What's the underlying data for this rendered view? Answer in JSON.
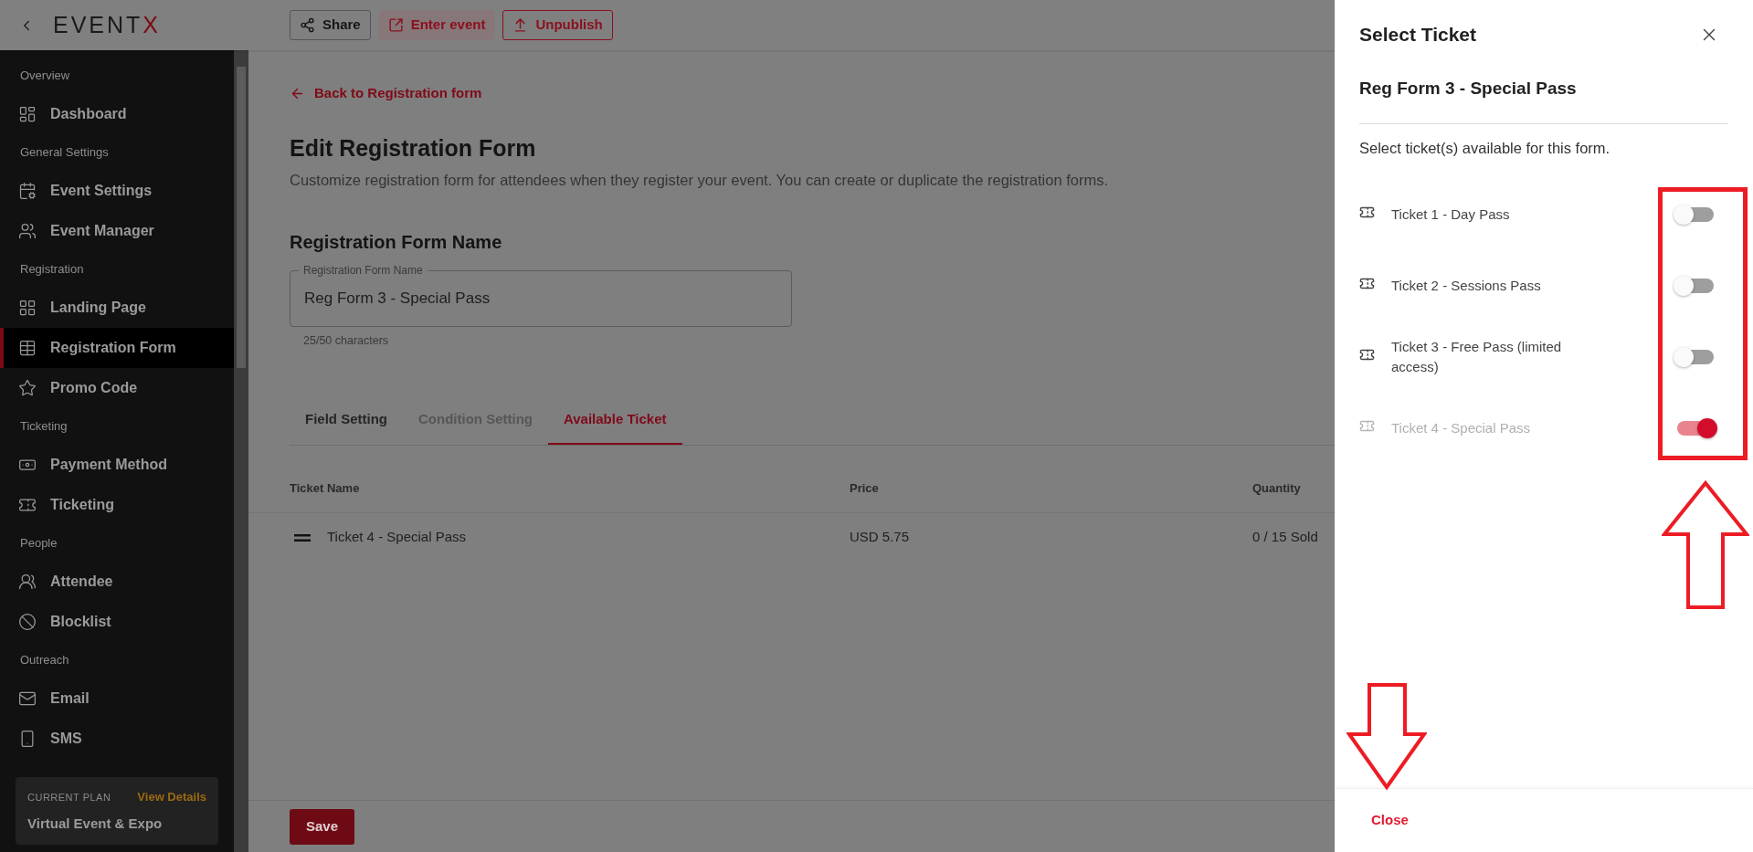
{
  "header": {
    "logo_main": "EVENT",
    "logo_accent": "X",
    "toolbar": [
      {
        "label": "Share",
        "kind": "outline"
      },
      {
        "label": "Enter event",
        "kind": "tinted"
      },
      {
        "label": "Unpublish",
        "kind": "danger"
      }
    ]
  },
  "sidebar": {
    "sections": [
      {
        "title": "Overview",
        "items": [
          {
            "label": "Dashboard",
            "selected": false
          }
        ]
      },
      {
        "title": "General Settings",
        "items": [
          {
            "label": "Event Settings",
            "selected": false
          },
          {
            "label": "Event Manager",
            "selected": false
          }
        ]
      },
      {
        "title": "Registration",
        "items": [
          {
            "label": "Landing Page",
            "selected": false
          },
          {
            "label": "Registration Form",
            "selected": true
          },
          {
            "label": "Promo Code",
            "selected": false
          }
        ]
      },
      {
        "title": "Ticketing",
        "items": [
          {
            "label": "Payment Method",
            "selected": false
          },
          {
            "label": "Ticketing",
            "selected": false
          }
        ]
      },
      {
        "title": "People",
        "items": [
          {
            "label": "Attendee",
            "selected": false
          },
          {
            "label": "Blocklist",
            "selected": false
          }
        ]
      },
      {
        "title": "Outreach",
        "items": [
          {
            "label": "Email",
            "selected": false
          },
          {
            "label": "SMS",
            "selected": false
          }
        ]
      }
    ],
    "plan": {
      "caption": "CURRENT PLAN",
      "link": "View Details",
      "name": "Virtual Event & Expo"
    }
  },
  "page": {
    "back_link": "Back to Registration form",
    "title": "Edit Registration Form",
    "description": "Customize registration form for attendees when they register your event. You can create or duplicate the registration forms.",
    "section_title": "Registration Form Name",
    "name_field": {
      "label": "Registration Form Name",
      "value": "Reg Form 3 - Special Pass",
      "counter": "25/50 characters"
    },
    "tabs": [
      {
        "label": "Field Setting",
        "selected": false,
        "disabled": false
      },
      {
        "label": "Condition Setting",
        "selected": false,
        "disabled": true
      },
      {
        "label": "Available Ticket",
        "selected": true,
        "disabled": false
      }
    ],
    "table": {
      "columns": [
        "Ticket Name",
        "Price",
        "Quantity"
      ],
      "rows": [
        {
          "cells": [
            "Ticket 4 - Special Pass",
            "USD 5.75",
            "0 / 15 Sold"
          ]
        }
      ]
    },
    "save": "Save"
  },
  "drawer": {
    "title": "Select Ticket",
    "form_name": "Reg Form 3 - Special Pass",
    "instruction": "Select ticket(s) available for this form.",
    "tickets": [
      {
        "name": "Ticket 1 - Day Pass",
        "on": false,
        "disabled": false
      },
      {
        "name": "Ticket 2 - Sessions Pass",
        "on": false,
        "disabled": false
      },
      {
        "name": "Ticket 3 - Free Pass (limited access)",
        "on": false,
        "disabled": false
      },
      {
        "name": "Ticket 4 - Special Pass",
        "on": true,
        "disabled": true
      }
    ],
    "close": "Close"
  },
  "annotations": [
    {
      "kind": "frame"
    },
    {
      "kind": "arrow_up"
    },
    {
      "kind": "arrow_down"
    }
  ]
}
